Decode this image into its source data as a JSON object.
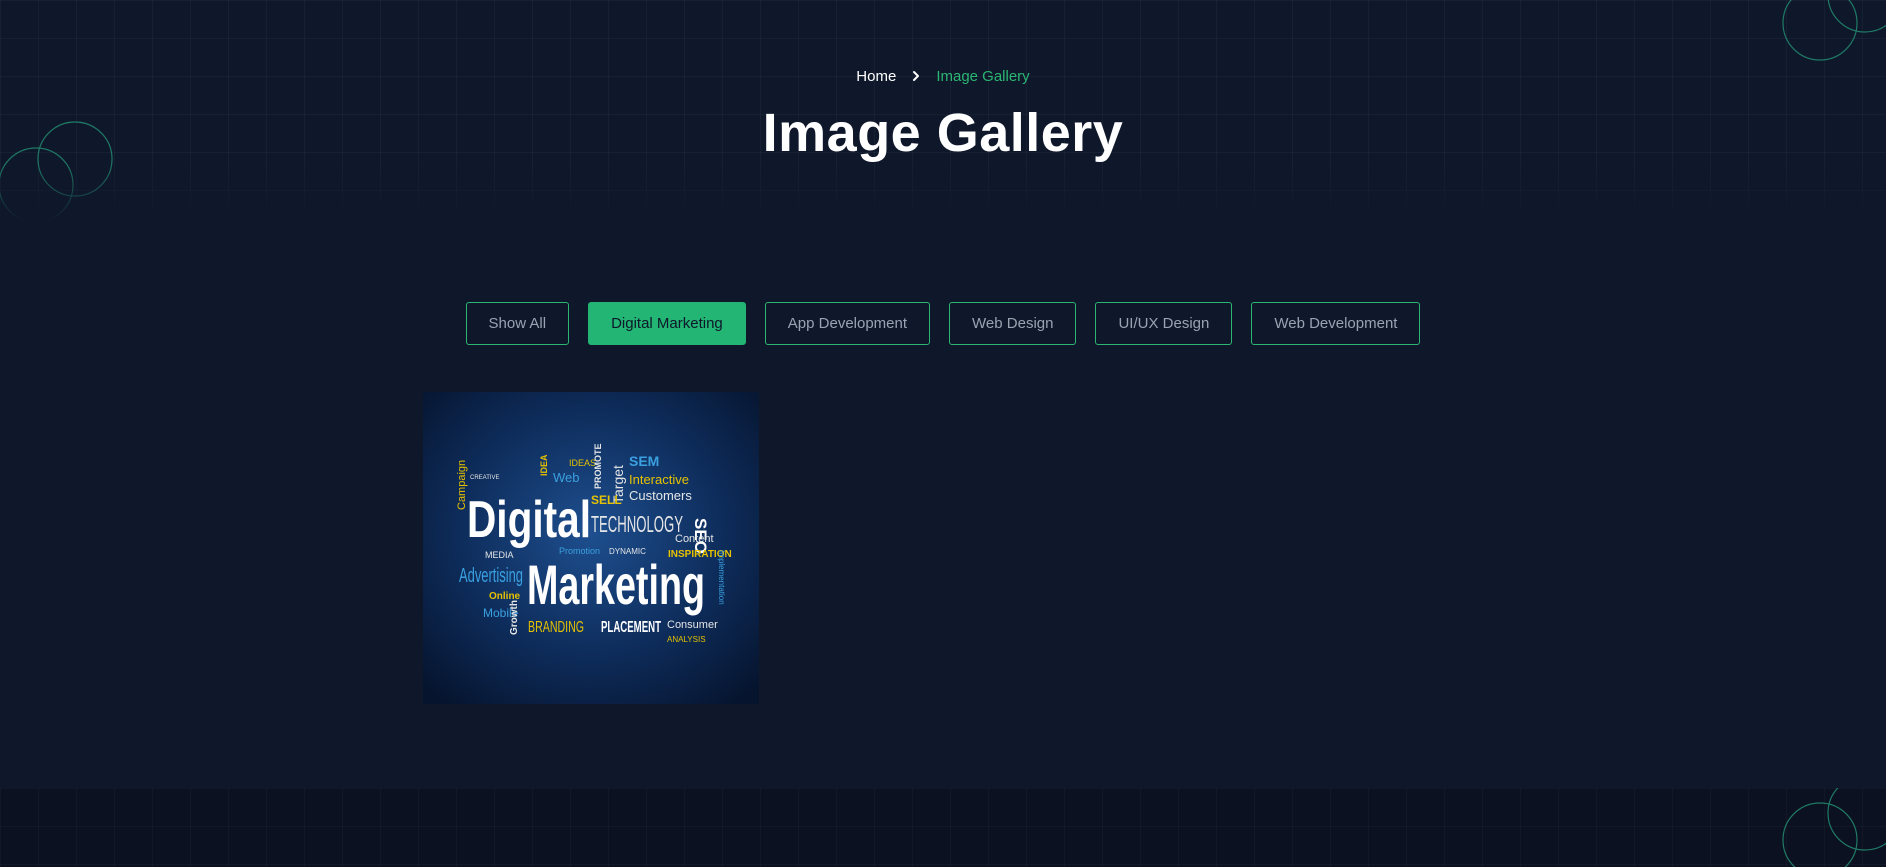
{
  "breadcrumb": {
    "home": "Home",
    "current": "Image Gallery"
  },
  "page": {
    "title": "Image Gallery"
  },
  "filters": [
    {
      "label": "Show All",
      "active": false
    },
    {
      "label": "Digital Marketing",
      "active": true
    },
    {
      "label": "App Development",
      "active": false
    },
    {
      "label": "Web Design",
      "active": false
    },
    {
      "label": "UI/UX Design",
      "active": false
    },
    {
      "label": "Web Development",
      "active": false
    }
  ],
  "gallery": {
    "items": [
      {
        "category": "Digital Marketing",
        "image_words": {
          "main1": "Digital",
          "main2": "Marketing",
          "technology": "TECHNOLOGY",
          "advertising": "Advertising",
          "branding": "BRANDING",
          "placement": "PLACEMENT",
          "consumer": "Consumer",
          "analysis": "ANALYSIS",
          "sem": "SEM",
          "seo": "SEO",
          "interactive": "Interactive",
          "customers": "Customers",
          "content": "Content",
          "inspiration": "INSPIRATION",
          "dynamic": "DYNAMIC",
          "promotion": "Promotion",
          "media": "MEDIA",
          "online": "Online",
          "mobile": "Mobile",
          "growth": "Growth",
          "sell": "SELL",
          "target": "Target",
          "web": "Web",
          "ideas": "IDEAS",
          "idea": "IDEA",
          "promote": "PROMOTE",
          "creative": "CREATIVE",
          "campaign": "Campaign",
          "implementation": "Implementation"
        }
      }
    ]
  },
  "colors": {
    "background": "#0f172a",
    "accent": "#22b573",
    "footer": "#0b1120"
  }
}
